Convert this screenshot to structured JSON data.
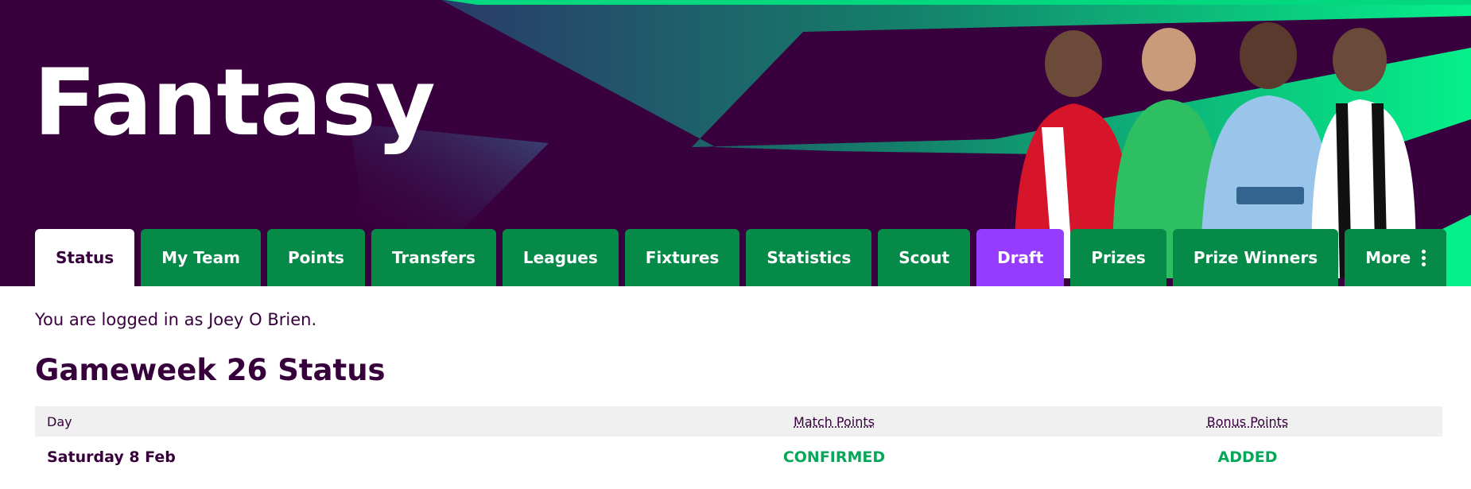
{
  "brand": {
    "title": "Fantasy"
  },
  "nav": {
    "tabs": [
      {
        "label": "Status",
        "active": true
      },
      {
        "label": "My Team"
      },
      {
        "label": "Points"
      },
      {
        "label": "Transfers"
      },
      {
        "label": "Leagues"
      },
      {
        "label": "Fixtures"
      },
      {
        "label": "Statistics"
      },
      {
        "label": "Scout"
      },
      {
        "label": "Draft",
        "accent": "#963cff"
      },
      {
        "label": "Prizes"
      },
      {
        "label": "Prize Winners"
      },
      {
        "label": "More",
        "icon": "more-vertical-icon"
      }
    ]
  },
  "user": {
    "login_text": "You are logged in as Joey O Brien."
  },
  "status": {
    "heading": "Gameweek 26 Status",
    "columns": {
      "day": "Day",
      "match": "Match Points",
      "bonus": "Bonus Points"
    },
    "rows": [
      {
        "day": "Saturday 8 Feb",
        "match": "CONFIRMED",
        "bonus": "ADDED"
      }
    ]
  },
  "colors": {
    "brand_purple": "#38003c",
    "tab_green": "#068a48",
    "draft_purple": "#963cff",
    "status_green": "#05a859",
    "header_gray": "#f0f0f0"
  }
}
